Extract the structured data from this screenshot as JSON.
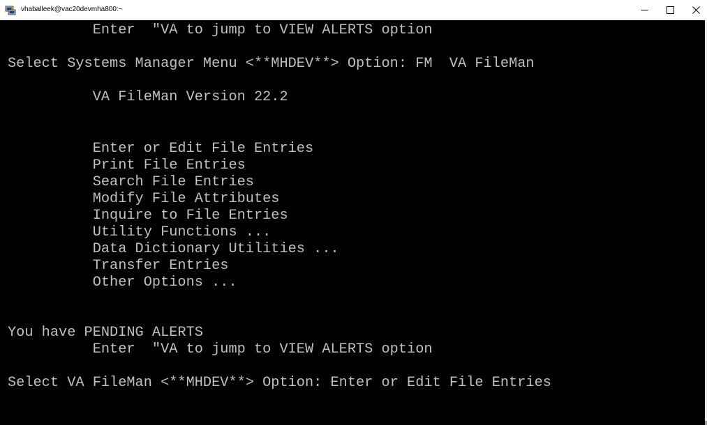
{
  "window": {
    "title": "vhaballeek@vac20devmha800:~",
    "icon": "putty-icon",
    "controls": {
      "minimize": "–",
      "maximize": "☐",
      "close": "✕"
    }
  },
  "terminal": {
    "background": "#000000",
    "foreground": "#c0c0c0",
    "lines": [
      "          Enter  \"VA to jump to VIEW ALERTS option",
      "",
      "Select Systems Manager Menu <**MHDEV**> Option: FM  VA FileMan",
      "",
      "          VA FileMan Version 22.2",
      "",
      "",
      "",
      "          Enter or Edit File Entries",
      "          Print File Entries",
      "          Search File Entries",
      "          Modify File Attributes",
      "          Inquire to File Entries",
      "          Utility Functions ...",
      "          Data Dictionary Utilities ...",
      "          Transfer Entries",
      "          Other Options ...",
      "",
      "",
      "You have PENDING ALERTS",
      "          Enter  \"VA to jump to VIEW ALERTS option",
      "",
      "Select VA FileMan <**MHDEV**> Option: Enter or Edit File Entries"
    ]
  }
}
